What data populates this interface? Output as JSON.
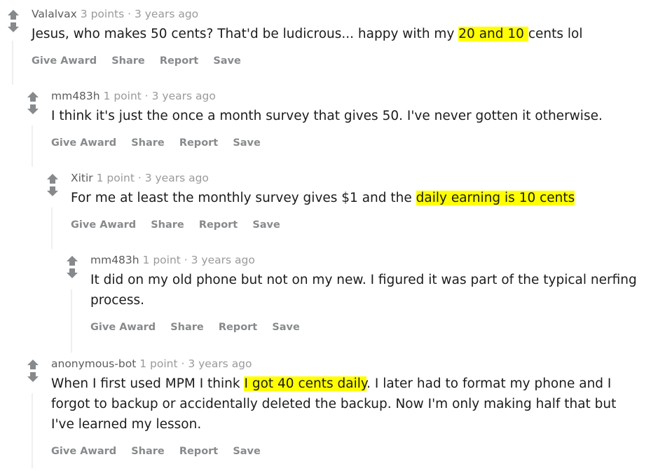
{
  "theme": {
    "highlight_color": "#ffff00",
    "author_color": "#5c5c5e",
    "meta_color": "#9a9a9c",
    "body_color": "#1c1c1c",
    "action_color": "#878a8c",
    "threadline_color": "#edeff1",
    "arrow_color": "#878a8c",
    "background": "#ffffff"
  },
  "actions": {
    "give_award": "Give Award",
    "share": "Share",
    "report": "Report",
    "save": "Save"
  },
  "icons": {
    "upvote": "upvote-arrow-icon",
    "downvote": "downvote-arrow-icon"
  },
  "comments": [
    {
      "id": "c0",
      "level": 0,
      "author": "Valalvax",
      "meta": "3 points · 3 years ago",
      "points": "3 points",
      "age": "3 years ago",
      "body_parts": [
        {
          "text": "Jesus, who makes 50 cents? That'd be ludicrous... happy with my ",
          "highlight": false
        },
        {
          "text": "20 and 10 ",
          "highlight": true
        },
        {
          "text": "cents lol",
          "highlight": false
        }
      ]
    },
    {
      "id": "c1",
      "level": 1,
      "author": "mm483h",
      "meta": "1 point · 3 years ago",
      "points": "1 point",
      "age": "3 years ago",
      "body_parts": [
        {
          "text": "I think it's just the once a month survey that gives 50. I've never gotten it otherwise.",
          "highlight": false
        }
      ]
    },
    {
      "id": "c2",
      "level": 2,
      "author": "Xitir",
      "meta": "1 point · 3 years ago",
      "points": "1 point",
      "age": "3 years ago",
      "body_parts": [
        {
          "text": "For me at least the monthly survey gives $1 and the ",
          "highlight": false
        },
        {
          "text": "daily earning is 10 cents",
          "highlight": true
        }
      ]
    },
    {
      "id": "c3",
      "level": 3,
      "author": "mm483h",
      "meta": "1 point · 3 years ago",
      "points": "1 point",
      "age": "3 years ago",
      "body_parts": [
        {
          "text": "It did on my old phone but not on my new. I figured it was part of the typical nerfing process.",
          "highlight": false
        }
      ]
    },
    {
      "id": "c4",
      "level": 1,
      "author": "anonymous-bot",
      "meta": "1 point · 3 years ago",
      "points": "1 point",
      "age": "3 years ago",
      "body_parts": [
        {
          "text": "When I first used MPM I think ",
          "highlight": false
        },
        {
          "text": "I got 40 cents daily",
          "highlight": true
        },
        {
          "text": ". I later had to format my phone and I forgot to backup or accidentally deleted the backup. Now I'm only making half that but I've learned my lesson.",
          "highlight": false
        }
      ]
    }
  ]
}
